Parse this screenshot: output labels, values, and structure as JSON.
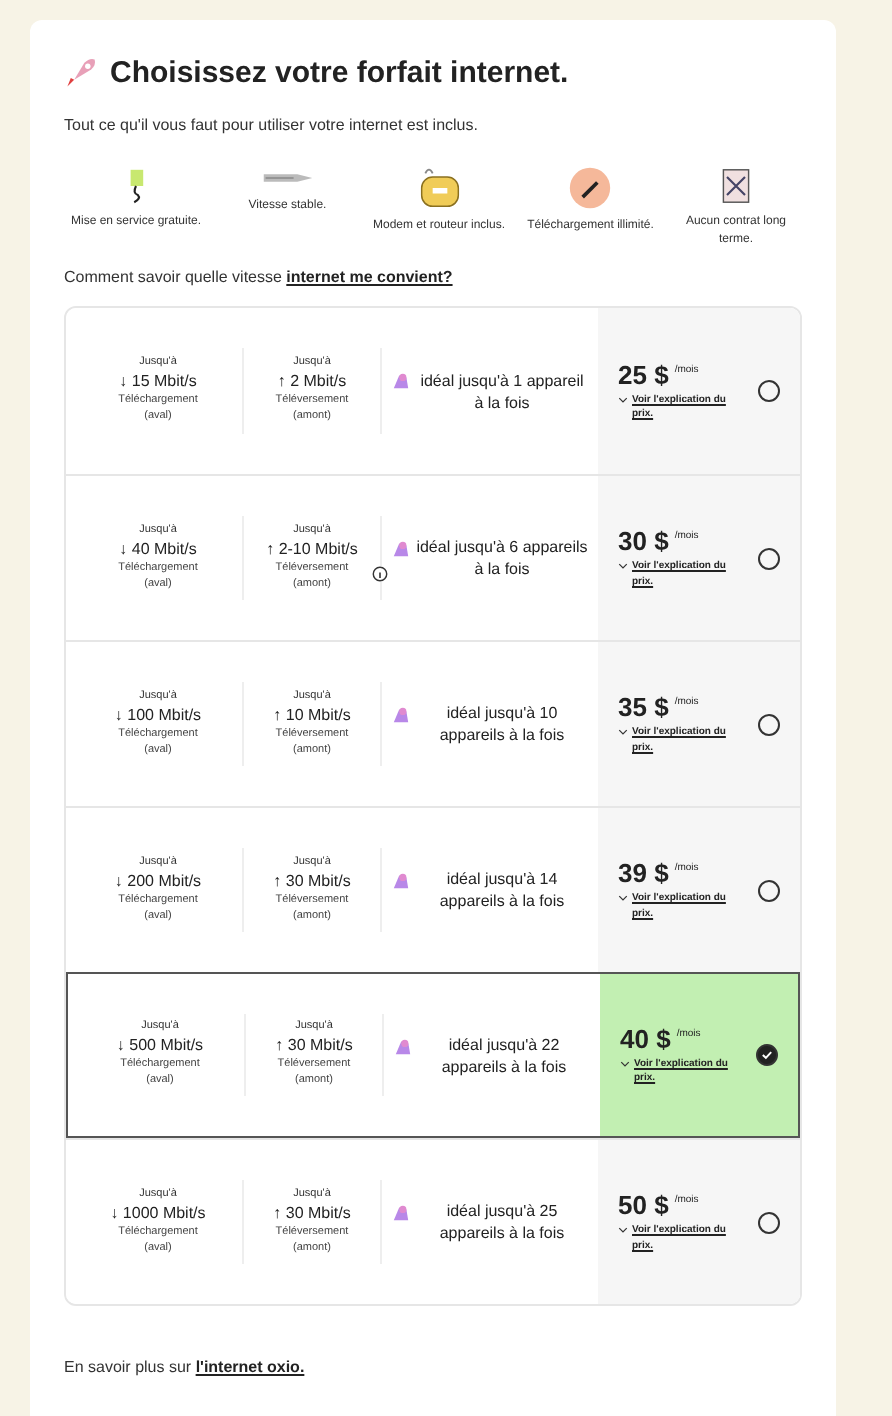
{
  "title": "Choisissez votre forfait internet.",
  "subtitle": "Tout ce qu'il vous faut pour utiliser votre internet est inclus.",
  "features": [
    {
      "kind": "power",
      "label": "Mise en service gratuite."
    },
    {
      "kind": "speed",
      "label": "Vitesse stable."
    },
    {
      "kind": "modem",
      "label": "Modem et routeur inclus."
    },
    {
      "kind": "gauge",
      "label": "Téléchargement illimité."
    },
    {
      "kind": "contract",
      "label": "Aucun contrat long terme."
    }
  ],
  "question": {
    "text": "Comment savoir quelle vitesse ",
    "link": "internet me convient?"
  },
  "plans": [
    {
      "down_pre": "Jusqu'à",
      "down": "↓ 15 Mbit/s",
      "down_label": "Téléchargement (aval)",
      "up_pre": "Jusqu'à",
      "up": "↑ 2 Mbit/s",
      "up_label": "Téléversement (amont)",
      "info": false,
      "devices": "idéal jusqu'à 1 appareil à la fois",
      "price": "25 $",
      "unit": "/mois",
      "explain": "Voir l'explication du prix.",
      "selected": false
    },
    {
      "down_pre": "Jusqu'à",
      "down": "↓ 40 Mbit/s",
      "down_label": "Téléchargement (aval)",
      "up_pre": "Jusqu'à",
      "up": "↑ 2-10 Mbit/s",
      "up_label": "Téléversement (amont)",
      "info": true,
      "devices": "idéal jusqu'à 6 appareils à la fois",
      "price": "30 $",
      "unit": "/mois",
      "explain": "Voir l'explication du prix.",
      "selected": false
    },
    {
      "down_pre": "Jusqu'à",
      "down": "↓ 100 Mbit/s",
      "down_label": "Téléchargement (aval)",
      "up_pre": "Jusqu'à",
      "up": "↑ 10 Mbit/s",
      "up_label": "Téléversement (amont)",
      "info": false,
      "devices": "idéal jusqu'à 10 appareils à la fois",
      "price": "35 $",
      "unit": "/mois",
      "explain": "Voir l'explication du prix.",
      "selected": false
    },
    {
      "down_pre": "Jusqu'à",
      "down": "↓ 200 Mbit/s",
      "down_label": "Téléchargement (aval)",
      "up_pre": "Jusqu'à",
      "up": "↑ 30 Mbit/s",
      "up_label": "Téléversement (amont)",
      "info": false,
      "devices": "idéal jusqu'à 14 appareils à la fois",
      "price": "39 $",
      "unit": "/mois",
      "explain": "Voir l'explication du prix.",
      "selected": false
    },
    {
      "down_pre": "Jusqu'à",
      "down": "↓ 500 Mbit/s",
      "down_label": "Téléchargement (aval)",
      "up_pre": "Jusqu'à",
      "up": "↑ 30 Mbit/s",
      "up_label": "Téléversement (amont)",
      "info": false,
      "devices": "idéal jusqu'à 22 appareils à la fois",
      "price": "40 $",
      "unit": "/mois",
      "explain": "Voir l'explication du prix.",
      "selected": true
    },
    {
      "down_pre": "Jusqu'à",
      "down": "↓ 1000 Mbit/s",
      "down_label": "Téléchargement (aval)",
      "up_pre": "Jusqu'à",
      "up": "↑ 30 Mbit/s",
      "up_label": "Téléversement (amont)",
      "info": false,
      "devices": "idéal jusqu'à 25 appareils à la fois",
      "price": "50 $",
      "unit": "/mois",
      "explain": "Voir l'explication du prix.",
      "selected": false
    }
  ],
  "footer": {
    "text": "En savoir plus sur ",
    "link": "l'internet oxio."
  }
}
